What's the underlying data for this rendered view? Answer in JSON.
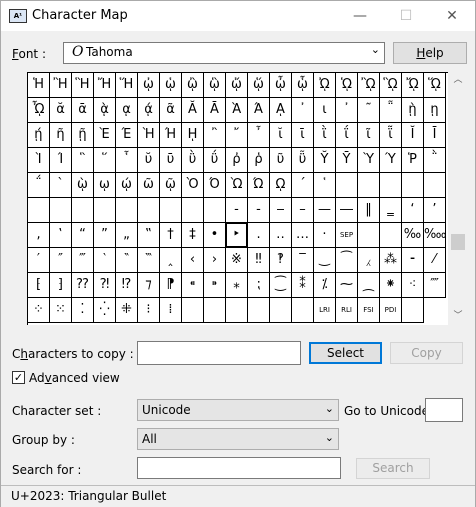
{
  "window": {
    "title": "Character Map"
  },
  "font": {
    "label": "Font :",
    "label_key": "F",
    "value": "Tahoma",
    "help": "Help",
    "help_key": "H"
  },
  "grid": {
    "selected": "‣",
    "rows": [
      [
        "Ἡ",
        "Ἢ",
        "Ἣ",
        "Ἤ",
        "Ἥ",
        "ᾠ",
        "ᾡ",
        "ᾢ",
        "ᾣ",
        "ᾤ",
        "ᾥ",
        "ᾦ",
        "ᾧ",
        "ᾨ",
        "ᾩ",
        "ᾪ",
        "ᾫ",
        "ᾬ",
        "ᾭ"
      ],
      [
        "ᾮ",
        "ᾰ",
        "ᾱ",
        "ᾲ",
        "ᾳ",
        "ᾴ",
        "ᾶ",
        "Ᾰ",
        "Ᾱ",
        "Ὰ",
        "Ά",
        "ᾼ",
        "᾽",
        "ι",
        "᾿",
        "῀",
        "῁",
        "ῂ",
        "ῃ"
      ],
      [
        "ῄ",
        "ῆ",
        "ῇ",
        "Ὲ",
        "Έ",
        "Ὴ",
        "Ή",
        "ῌ",
        "῍",
        "῎",
        "῏",
        "ῐ",
        "ῑ",
        "ῒ",
        "ΐ",
        "ῖ",
        "ῗ",
        "Ῐ",
        "Ῑ"
      ],
      [
        "Ὶ",
        "Ί",
        "῝",
        "῞",
        "῟",
        "ῠ",
        "ῡ",
        "ῢ",
        "ΰ",
        "ῤ",
        "ῥ",
        "ῦ",
        "ῧ",
        "Ῠ",
        "Ῡ",
        "Ὺ",
        "Ύ",
        "Ῥ",
        "῭"
      ],
      [
        "΅",
        "`",
        "ῲ",
        "ῳ",
        "ῴ",
        "ῶ",
        "ῷ",
        "Ὸ",
        "Ό",
        "Ὼ",
        "Ώ",
        "ῼ",
        "´",
        "῾",
        " ",
        " ",
        " ",
        " ",
        " "
      ],
      [
        " ",
        " ",
        " ",
        " ",
        " ",
        " ",
        " ",
        " ",
        " ",
        "‐",
        "‑",
        "‒",
        "–",
        "—",
        "―",
        "‖",
        "‗",
        "‘",
        "’"
      ],
      [
        "‚",
        "‛",
        "“",
        "”",
        "„",
        "‟",
        "†",
        "‡",
        "•",
        "‣",
        "․",
        "‥",
        "…",
        "‧",
        "SEP",
        " ",
        " ",
        "‰",
        "‱"
      ],
      [
        "′",
        "″",
        "‴",
        "‵",
        "‶",
        "‷",
        "‸",
        "‹",
        "›",
        "※",
        "‼",
        "‽",
        "‾",
        "‿",
        "⁀",
        "⁁",
        "⁂",
        "⁃",
        "⁄"
      ],
      [
        "⁅",
        "⁆",
        "⁇",
        "⁈",
        "⁉",
        "⁊",
        "⁋",
        "⁌",
        "⁍",
        "⁎",
        "⁏",
        "⁐",
        "⁑",
        "⁒",
        "⁓",
        "⁔",
        "⁕",
        "⁖",
        "⁗"
      ],
      [
        "⁘",
        "⁙",
        "⁚",
        "⁛",
        "⁜",
        "⁝",
        "⁞",
        " ",
        " ",
        " ",
        " ",
        " ",
        " ",
        "LRI",
        "RLI",
        "FSI",
        "PDI",
        " "
      ]
    ]
  },
  "copy": {
    "label": "Characters to copy :",
    "label_key": "h",
    "value": "",
    "select": "Select",
    "copy": "Copy"
  },
  "advanced": {
    "label": "Advanced view",
    "label_key": "v",
    "checked": "✓"
  },
  "charset": {
    "label": "Character set :",
    "value": "Unicode",
    "goto_label": "Go to Unicode :",
    "goto_value": ""
  },
  "groupby": {
    "label": "Group by :",
    "value": "All"
  },
  "search": {
    "label": "Search for :",
    "value": "",
    "button": "Search"
  },
  "status": {
    "text": "U+2023: Triangular Bullet"
  }
}
